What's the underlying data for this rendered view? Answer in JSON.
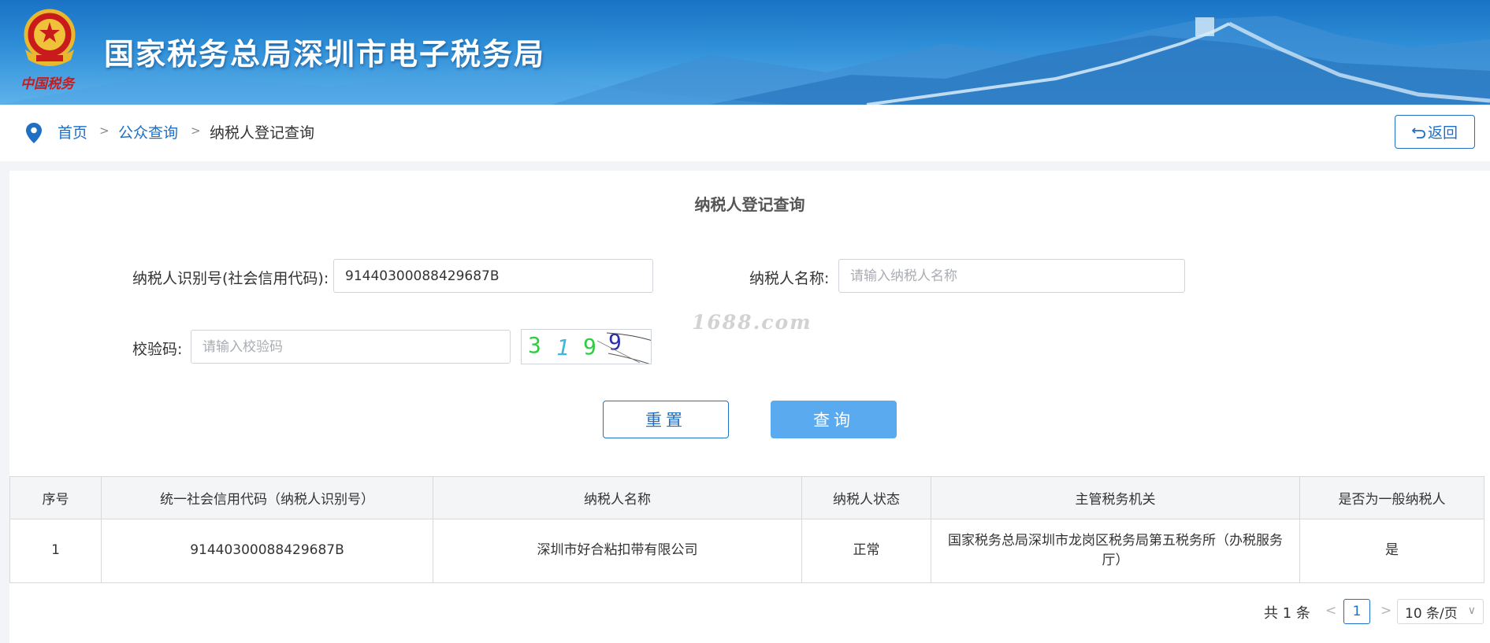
{
  "header": {
    "site_title": "国家税务总局深圳市电子税务局",
    "emblem_caption": "中国税务"
  },
  "breadcrumb": {
    "items": [
      "首页",
      "公众查询",
      "纳税人登记查询"
    ],
    "separator": ">"
  },
  "back_button": {
    "icon": "undo-icon",
    "label": "返回"
  },
  "form": {
    "title": "纳税人登记查询",
    "taxpayer_id_label": "纳税人识别号(社会信用代码):",
    "taxpayer_id_value": "91440300088429687B",
    "taxpayer_name_label": "纳税人名称:",
    "taxpayer_name_placeholder": "请输入纳税人名称",
    "captcha_label": "校验码:",
    "captcha_placeholder": "请输入校验码",
    "captcha_digits": [
      "3",
      "1",
      "9",
      "9"
    ],
    "watermark": "1688.com",
    "reset_label": "重置",
    "query_label": "查询"
  },
  "table": {
    "columns": [
      "序号",
      "统一社会信用代码（纳税人识别号）",
      "纳税人名称",
      "纳税人状态",
      "主管税务机关",
      "是否为一般纳税人"
    ],
    "rows": [
      [
        "1",
        "91440300088429687B",
        "深圳市好合粘扣带有限公司",
        "正常",
        "国家税务总局深圳市龙岗区税务局第五税务所（办税服务厅）",
        "是"
      ]
    ]
  },
  "pagination": {
    "total_text": "共 1 条",
    "prev": "<",
    "current_page": "1",
    "next": ">",
    "page_size": "10 条/页"
  },
  "colors": {
    "primary": "#1f6fc4",
    "query_button": "#5aaaf0",
    "banner": "#2f8fd8"
  }
}
